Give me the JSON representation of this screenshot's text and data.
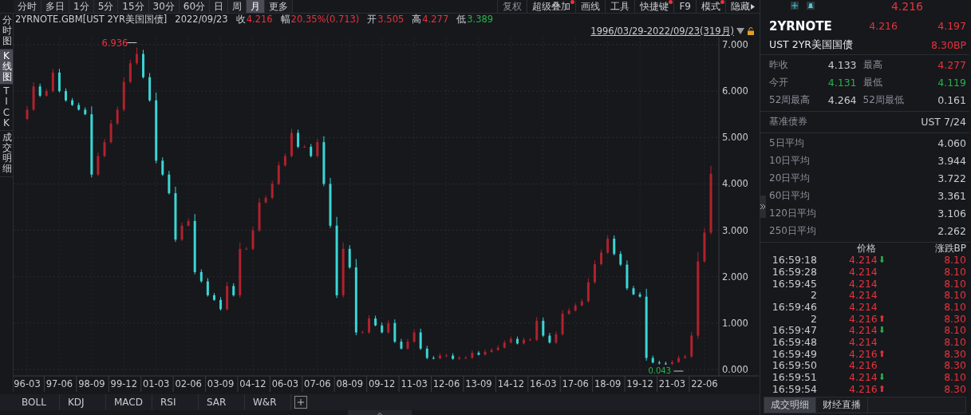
{
  "periods": [
    {
      "label": "分时",
      "selected": false
    },
    {
      "label": "多日",
      "selected": false
    },
    {
      "label": "1分",
      "selected": false
    },
    {
      "label": "5分",
      "selected": false
    },
    {
      "label": "15分",
      "selected": false
    },
    {
      "label": "30分",
      "selected": false
    },
    {
      "label": "60分",
      "selected": false
    },
    {
      "label": "日",
      "selected": false
    },
    {
      "label": "周",
      "selected": false
    },
    {
      "label": "月",
      "selected": true
    },
    {
      "label": "更多",
      "selected": false
    }
  ],
  "tools": [
    {
      "label": "复权",
      "dot": false,
      "disabled": true
    },
    {
      "label": "超级叠加",
      "dot": true,
      "disabled": false
    },
    {
      "label": "画线",
      "dot": false,
      "disabled": false
    },
    {
      "label": "工具",
      "dot": false,
      "disabled": false
    },
    {
      "label": "快捷键",
      "dot": true,
      "disabled": false
    },
    {
      "label": "F9",
      "dot": false,
      "disabled": false
    },
    {
      "label": "模式",
      "dot": true,
      "disabled": false
    },
    {
      "label": "隐藏",
      "dot": false,
      "disabled": false
    }
  ],
  "side_tabs": [
    {
      "label": "分时图",
      "selected": false
    },
    {
      "label": "K线图",
      "selected": true
    },
    {
      "label": "TICK",
      "selected": false
    },
    {
      "label": "成交明细",
      "selected": false
    }
  ],
  "quote": {
    "symbol": "2YRNOTE.GBM[UST 2YR美国国债]",
    "date": "2022/09/23",
    "fields": [
      {
        "label": "收",
        "value": "4.216",
        "color": "#e8323c"
      },
      {
        "label": "幅",
        "value": "20.35%(0.713)",
        "color": "#e8323c"
      },
      {
        "label": "开",
        "value": "3.505",
        "color": "#e8323c"
      },
      {
        "label": "高",
        "value": "4.277",
        "color": "#e8323c"
      },
      {
        "label": "低",
        "value": "3.389",
        "color": "#27b24a"
      }
    ]
  },
  "range": "1996/03/29-2022/09/23(319月)",
  "chart": {
    "chart_data": {
      "type": "candlestick",
      "grid": true,
      "ylim": [
        0,
        7
      ],
      "yticks": [
        {
          "value": 0,
          "label": "0.000"
        },
        {
          "value": 1,
          "label": "1.000"
        },
        {
          "value": 2,
          "label": "2.000"
        },
        {
          "value": 3,
          "label": "3.000"
        },
        {
          "value": 4,
          "label": "4.000"
        },
        {
          "value": 5,
          "label": "5.000"
        },
        {
          "value": 6,
          "label": "6.000"
        },
        {
          "value": 7,
          "label": "7.000"
        }
      ],
      "categories": [
        "96-03",
        null,
        null,
        null,
        null,
        "97-06",
        null,
        null,
        null,
        null,
        "98-09",
        null,
        null,
        null,
        null,
        "99-12",
        null,
        null,
        null,
        null,
        "01-03",
        null,
        null,
        null,
        null,
        "02-06",
        null,
        null,
        null,
        null,
        "03-09",
        null,
        null,
        null,
        null,
        "04-12",
        null,
        null,
        null,
        null,
        "06-03",
        null,
        null,
        null,
        null,
        "07-06",
        null,
        null,
        null,
        null,
        "08-09",
        null,
        null,
        null,
        null,
        "09-12",
        null,
        null,
        null,
        null,
        "11-03",
        null,
        null,
        null,
        null,
        "12-06",
        null,
        null,
        null,
        null,
        "13-09",
        null,
        null,
        null,
        null,
        "14-12",
        null,
        null,
        null,
        null,
        "16-03",
        null,
        null,
        null,
        null,
        "17-06",
        null,
        null,
        null,
        null,
        "18-09",
        null,
        null,
        null,
        null,
        "19-12",
        null,
        null,
        null,
        null,
        "21-03",
        null,
        null,
        null,
        null,
        "22-06",
        null
      ],
      "ohlc": [
        [
          5.4,
          5.68,
          5.37,
          5.6
        ],
        [
          5.6,
          6.19,
          5.57,
          6.1
        ],
        [
          6.1,
          6.16,
          5.87,
          5.9
        ],
        [
          5.9,
          6.05,
          5.88,
          6.0
        ],
        [
          6.0,
          6.48,
          5.97,
          6.4
        ],
        [
          6.4,
          6.48,
          5.97,
          6.0
        ],
        [
          6.0,
          6.06,
          5.77,
          5.8
        ],
        [
          5.8,
          5.85,
          5.68,
          5.7
        ],
        [
          5.7,
          5.75,
          5.58,
          5.6
        ],
        [
          5.6,
          5.65,
          5.48,
          5.5
        ],
        [
          5.5,
          5.67,
          4.14,
          4.2
        ],
        [
          4.2,
          4.68,
          4.17,
          4.6
        ],
        [
          4.6,
          4.97,
          4.57,
          4.9
        ],
        [
          4.9,
          5.38,
          4.87,
          5.3
        ],
        [
          5.3,
          5.67,
          5.27,
          5.6
        ],
        [
          5.6,
          6.3,
          5.56,
          6.2
        ],
        [
          6.2,
          6.68,
          6.17,
          6.6
        ],
        [
          6.6,
          6.94,
          6.57,
          6.8
        ],
        [
          6.8,
          6.89,
          6.27,
          6.3
        ],
        [
          6.3,
          6.39,
          5.77,
          5.8
        ],
        [
          5.8,
          5.97,
          4.44,
          4.5
        ],
        [
          4.5,
          4.57,
          4.17,
          4.2
        ],
        [
          4.2,
          4.28,
          3.77,
          3.8
        ],
        [
          3.8,
          3.94,
          2.75,
          2.8
        ],
        [
          2.8,
          3.17,
          2.77,
          3.1
        ],
        [
          3.1,
          3.25,
          3.08,
          3.2
        ],
        [
          3.2,
          3.35,
          2.05,
          2.1
        ],
        [
          2.1,
          2.16,
          1.87,
          1.9
        ],
        [
          1.9,
          1.97,
          1.57,
          1.6
        ],
        [
          1.6,
          1.65,
          1.48,
          1.5
        ],
        [
          1.5,
          1.56,
          1.27,
          1.3
        ],
        [
          1.3,
          1.89,
          1.27,
          1.8
        ],
        [
          1.8,
          1.86,
          1.57,
          1.6
        ],
        [
          1.6,
          2.74,
          1.55,
          2.6
        ],
        [
          2.6,
          2.64,
          2.58,
          2.6
        ],
        [
          2.6,
          3.08,
          2.57,
          3.0
        ],
        [
          3.0,
          3.7,
          2.96,
          3.6
        ],
        [
          3.6,
          3.75,
          3.58,
          3.7
        ],
        [
          3.7,
          4.07,
          3.67,
          4.0
        ],
        [
          4.0,
          4.48,
          3.97,
          4.4
        ],
        [
          4.4,
          4.66,
          4.37,
          4.6
        ],
        [
          4.6,
          5.19,
          4.57,
          5.1
        ],
        [
          5.1,
          5.17,
          4.77,
          4.8
        ],
        [
          4.8,
          4.84,
          4.78,
          4.8
        ],
        [
          4.8,
          4.86,
          4.57,
          4.6
        ],
        [
          4.6,
          4.97,
          4.57,
          4.9
        ],
        [
          4.9,
          5.03,
          3.95,
          4.0
        ],
        [
          4.0,
          4.13,
          3.05,
          3.1
        ],
        [
          3.1,
          3.29,
          1.54,
          1.6
        ],
        [
          1.6,
          2.74,
          1.55,
          2.6
        ],
        [
          2.6,
          2.68,
          2.17,
          2.2
        ],
        [
          2.2,
          2.38,
          0.74,
          0.8
        ],
        [
          0.8,
          0.84,
          0.78,
          0.8
        ],
        [
          0.8,
          1.17,
          0.77,
          1.1
        ],
        [
          1.1,
          1.16,
          0.93,
          0.95
        ],
        [
          0.95,
          1.01,
          0.78,
          0.8
        ],
        [
          0.8,
          1.06,
          0.77,
          1.0
        ],
        [
          1.0,
          1.08,
          0.57,
          0.6
        ],
        [
          0.6,
          0.66,
          0.43,
          0.45
        ],
        [
          0.45,
          0.66,
          0.43,
          0.6
        ],
        [
          0.6,
          0.86,
          0.57,
          0.8
        ],
        [
          0.8,
          0.88,
          0.42,
          0.45
        ],
        [
          0.45,
          0.51,
          0.22,
          0.25
        ],
        [
          0.25,
          0.29,
          0.22,
          0.24
        ],
        [
          0.24,
          0.35,
          0.22,
          0.3
        ],
        [
          0.3,
          0.34,
          0.28,
          0.3
        ],
        [
          0.3,
          0.35,
          0.21,
          0.23
        ],
        [
          0.23,
          0.29,
          0.21,
          0.25
        ],
        [
          0.25,
          0.29,
          0.23,
          0.25
        ],
        [
          0.25,
          0.41,
          0.23,
          0.36
        ],
        [
          0.36,
          0.4,
          0.3,
          0.32
        ],
        [
          0.32,
          0.43,
          0.3,
          0.38
        ],
        [
          0.38,
          0.46,
          0.36,
          0.42
        ],
        [
          0.42,
          0.52,
          0.4,
          0.47
        ],
        [
          0.47,
          0.63,
          0.45,
          0.58
        ],
        [
          0.58,
          0.71,
          0.56,
          0.66
        ],
        [
          0.66,
          0.71,
          0.54,
          0.56
        ],
        [
          0.56,
          0.69,
          0.54,
          0.64
        ],
        [
          0.64,
          0.68,
          0.62,
          0.64
        ],
        [
          0.64,
          1.13,
          0.61,
          1.05
        ],
        [
          1.05,
          1.12,
          0.7,
          0.73
        ],
        [
          0.73,
          0.79,
          0.56,
          0.58
        ],
        [
          0.58,
          0.82,
          0.55,
          0.76
        ],
        [
          0.76,
          1.28,
          0.73,
          1.2
        ],
        [
          1.2,
          1.32,
          1.18,
          1.27
        ],
        [
          1.27,
          1.43,
          1.25,
          1.38
        ],
        [
          1.38,
          1.52,
          1.36,
          1.47
        ],
        [
          1.47,
          1.96,
          1.44,
          1.88
        ],
        [
          1.88,
          2.35,
          1.85,
          2.27
        ],
        [
          2.27,
          2.59,
          2.24,
          2.52
        ],
        [
          2.52,
          2.89,
          2.49,
          2.82
        ],
        [
          2.82,
          2.89,
          2.46,
          2.49
        ],
        [
          2.49,
          2.55,
          2.23,
          2.26
        ],
        [
          2.26,
          2.35,
          1.71,
          1.75
        ],
        [
          1.75,
          1.8,
          1.6,
          1.62
        ],
        [
          1.62,
          1.67,
          1.55,
          1.57
        ],
        [
          1.57,
          1.74,
          0.19,
          0.25
        ],
        [
          0.25,
          0.3,
          0.13,
          0.15
        ],
        [
          0.15,
          0.19,
          0.11,
          0.13
        ],
        [
          0.13,
          0.17,
          0.1,
          0.12
        ],
        [
          0.12,
          0.2,
          0.1,
          0.16
        ],
        [
          0.16,
          0.3,
          0.14,
          0.25
        ],
        [
          0.25,
          0.32,
          0.23,
          0.28
        ],
        [
          0.28,
          0.81,
          0.25,
          0.73
        ],
        [
          0.73,
          2.53,
          0.66,
          2.33
        ],
        [
          2.33,
          3.05,
          2.3,
          2.95
        ],
        [
          2.95,
          4.39,
          2.91,
          4.22
        ]
      ],
      "annotations": [
        "6.936",
        "0.043"
      ]
    }
  },
  "indicator_tabs": [
    "BOLL",
    "KDJ",
    "MACD",
    "RSI",
    "SAR",
    "W&R"
  ],
  "panel": {
    "last": "4.216",
    "code": "2YRNOTE",
    "price": "4.216",
    "prev": "4.197",
    "name": "UST 2YR美国国债",
    "change": "8.30BP",
    "stats": [
      [
        {
          "label": "昨收",
          "value": "4.133",
          "color": "#c9ccd1"
        },
        {
          "label": "最高",
          "value": "4.277",
          "color": "#e8323c"
        }
      ],
      [
        {
          "label": "今开",
          "value": "4.131",
          "color": "#27b24a"
        },
        {
          "label": "最低",
          "value": "4.119",
          "color": "#27b24a"
        }
      ],
      [
        {
          "label": "52周最高",
          "value": "4.264",
          "color": "#c9ccd1"
        },
        {
          "label": "52周最低",
          "value": "0.161",
          "color": "#c9ccd1"
        }
      ]
    ],
    "benchmark": {
      "label": "基准债券",
      "value": "UST 7/24"
    },
    "averages": [
      {
        "label": "5日平均",
        "value": "4.060"
      },
      {
        "label": "10日平均",
        "value": "3.944"
      },
      {
        "label": "20日平均",
        "value": "3.722"
      },
      {
        "label": "60日平均",
        "value": "3.361"
      },
      {
        "label": "120日平均",
        "value": "3.106"
      },
      {
        "label": "250日平均",
        "value": "2.262"
      }
    ],
    "trade_columns": [
      "价格",
      "涨跌BP"
    ],
    "trades": [
      {
        "time": "16:59:18",
        "price": "4.214",
        "arrow": "⬇",
        "color": "#27b24a",
        "change": "8.10"
      },
      {
        "time": "16:59:28",
        "price": "4.214",
        "change": "8.10"
      },
      {
        "time": "16:59:45",
        "price": "4.214",
        "change": "8.10"
      },
      {
        "time": "2",
        "price": "4.214",
        "change": "8.10"
      },
      {
        "time": "16:59:46",
        "price": "4.214",
        "change": "8.10"
      },
      {
        "time": "2",
        "price": "4.216",
        "arrow": "⬆",
        "color": "#e8323c",
        "change": "8.30"
      },
      {
        "time": "16:59:47",
        "price": "4.214",
        "arrow": "⬇",
        "color": "#27b24a",
        "change": "8.10"
      },
      {
        "time": "16:59:48",
        "price": "4.214",
        "change": "8.10"
      },
      {
        "time": "16:59:49",
        "price": "4.216",
        "arrow": "⬆",
        "color": "#e8323c",
        "change": "8.30"
      },
      {
        "time": "16:59:50",
        "price": "4.216",
        "change": "8.30"
      },
      {
        "time": "16:59:51",
        "price": "4.214",
        "arrow": "⬇",
        "color": "#27b24a",
        "change": "8.10"
      },
      {
        "time": "16:59:54",
        "price": "4.216",
        "arrow": "⬆",
        "color": "#e8323c",
        "change": "8.30"
      }
    ],
    "bottom_tabs": [
      {
        "label": "成交明细",
        "selected": true
      },
      {
        "label": "财经直播",
        "selected": false
      }
    ]
  }
}
